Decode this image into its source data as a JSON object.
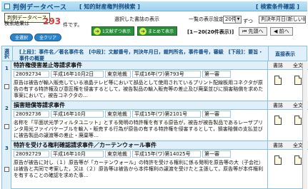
{
  "header": {
    "title": "判例データベース",
    "subtitle": "[ 知的財産権判例検索 ]",
    "search_cond": "[ 検索条件確認 ]",
    "tooltip": "判例データベース",
    "count_label": "検索結果は",
    "count_value": "293",
    "count_suffix": "件です。",
    "select_all": "全選択",
    "clear_all": "全クリア",
    "selected_label": "選択した書誌の表示",
    "btn_abstract": "1文献ずつ表示",
    "btn_together": "まとめて表示",
    "per_page_label": "一覧の表示設定",
    "per_page_value": "20件",
    "per_page_suffix": "ずつ",
    "sort_value": "判決年月日(新しい順)",
    "range_text": "[1－20(20件表示)]",
    "prev_label": "先頭へ",
    "next_label": "前へ"
  },
  "table": {
    "col_num": "選択",
    "col_info": "[上段]：事件名／著名事件名　[中段]：文献番号，判決年月日，裁判所名，事件番号，審級　[下段]：要旨・事件の概要",
    "col_links": "直接表示",
    "col_biblio": "書誌",
    "col_full": "全文"
  },
  "records": [
    {
      "num": "1",
      "title": "特許権侵害差止等請求事件",
      "doc_no": "28092734",
      "date": "平成16年10月2日",
      "court": "東京地裁",
      "case_no": "平成16年(ワ)第793号",
      "instance": "第一審",
      "body": "原告は被告が輸入販売している液晶テレビ等において部品として使用されているプリント配線板用コネクタが原告の有する特許権及び意匠権を侵害するとして，被告製品の輸入販売等の差止及び廃棄並びに損害賠償を求めた事案において，被告コネクタの…"
    },
    {
      "num": "2",
      "title": "損害賠償等請求事件",
      "doc_no": "28092736",
      "date": "平成16年10月",
      "court": "東京地裁",
      "case_no": "平成15年(ワ)第2101号",
      "instance": "第一審",
      "body": "名称を「平面状光学フィルタユニット」とする発明の特許権を有する原告が，被告が被告製品であるレーザプリンタ用光ファイバケーブルを輸入・販売する行為が原告の有する特許権を侵害するとして，損害賠償の支払並びに被告製品の譲渡等の差止・廃棄等…"
    },
    {
      "num": "3",
      "title": "特許を受ける権利確認請求事件／カーテンウォール事件",
      "doc_no": "28092729",
      "date": "平成16年10月",
      "court": "東京地裁",
      "case_no": "平成15年(ワ)第14025号",
      "instance": "第一審",
      "body": "原告が被告に対し（１）原告等が「カーテンウォール」の特許を受ける権利に係る発明を原告等の大（子会社）は被告と共同で考案した，又は（２）原告等は被告から本件権利の譲渡を受けたと主張して，原告等が本件権利を有することの確認を求めた事…"
    }
  ]
}
